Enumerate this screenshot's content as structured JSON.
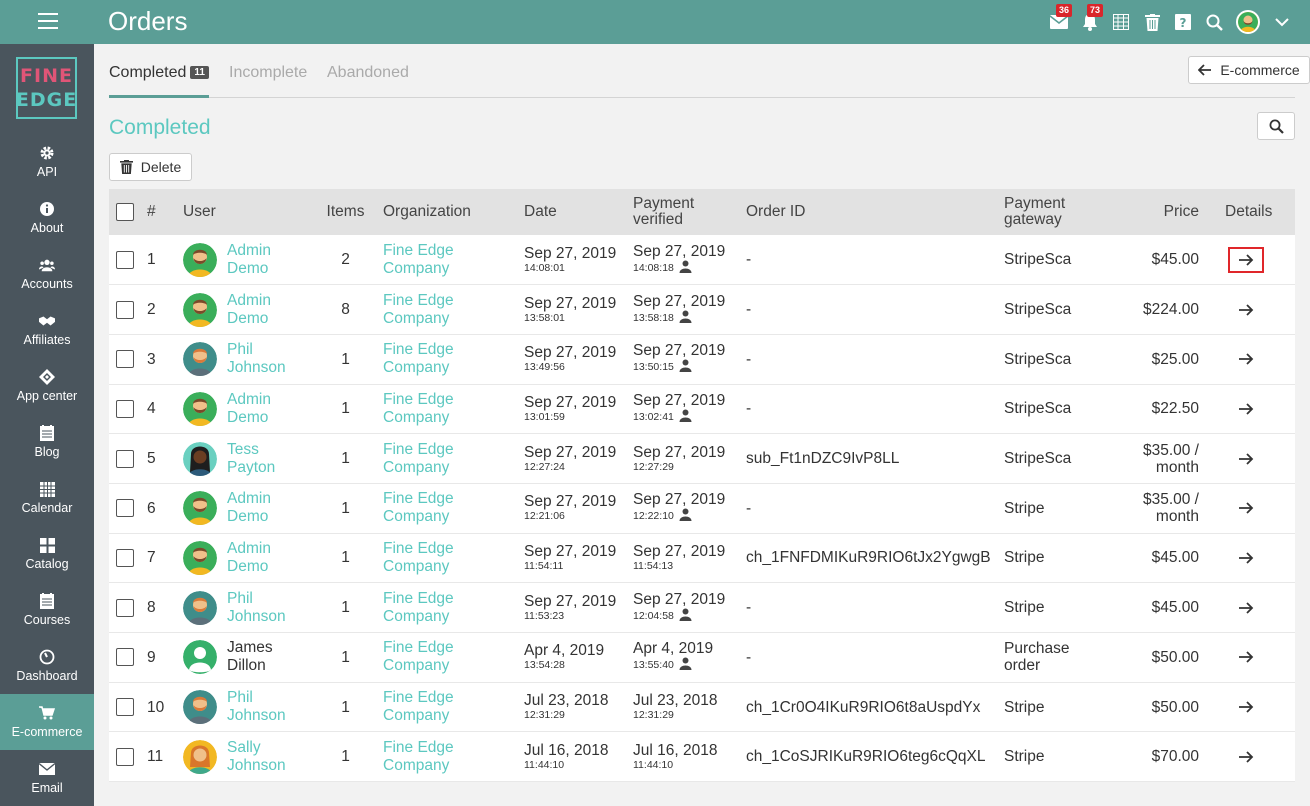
{
  "header": {
    "title": "Orders",
    "mail_badge": "36",
    "notifications_badge": "73"
  },
  "logo": {
    "line1": "FINE",
    "line2": "EDGE"
  },
  "sidebar": {
    "items": [
      {
        "label": "API",
        "icon": "gear-icon"
      },
      {
        "label": "About",
        "icon": "info-icon"
      },
      {
        "label": "Accounts",
        "icon": "users-icon"
      },
      {
        "label": "Affiliates",
        "icon": "handshake-icon"
      },
      {
        "label": "App center",
        "icon": "diamond-icon"
      },
      {
        "label": "Blog",
        "icon": "blog-icon"
      },
      {
        "label": "Calendar",
        "icon": "calendar-icon"
      },
      {
        "label": "Catalog",
        "icon": "grid-icon"
      },
      {
        "label": "Courses",
        "icon": "courses-icon"
      },
      {
        "label": "Dashboard",
        "icon": "dashboard-icon"
      },
      {
        "label": "E-commerce",
        "icon": "cart-icon"
      },
      {
        "label": "Email",
        "icon": "envelope-icon"
      }
    ],
    "active": "E-commerce"
  },
  "tabs": [
    {
      "label": "Completed",
      "count": "11"
    },
    {
      "label": "Incomplete"
    },
    {
      "label": "Abandoned"
    }
  ],
  "back_button": "E-commerce",
  "section_title": "Completed",
  "delete_button": "Delete",
  "table": {
    "headers": {
      "num": "#",
      "user": "User",
      "items": "Items",
      "organization": "Organization",
      "date": "Date",
      "payment_verified": "Payment verified",
      "order_id": "Order ID",
      "gateway": "Payment gateway",
      "price": "Price",
      "details": "Details"
    },
    "rows": [
      {
        "num": "1",
        "user": [
          "Admin",
          "Demo"
        ],
        "user_link": true,
        "avatar": "green",
        "items": "2",
        "org": [
          "Fine Edge",
          "Company"
        ],
        "date": "Sep 27, 2019",
        "time": "14:08:01",
        "pv_date": "Sep 27, 2019",
        "pv_time": "14:08:18",
        "pv_user": true,
        "order_id": "-",
        "gateway": "StripeSca",
        "price": "$45.00",
        "highlight": true
      },
      {
        "num": "2",
        "user": [
          "Admin",
          "Demo"
        ],
        "user_link": true,
        "avatar": "green",
        "items": "8",
        "org": [
          "Fine Edge",
          "Company"
        ],
        "date": "Sep 27, 2019",
        "time": "13:58:01",
        "pv_date": "Sep 27, 2019",
        "pv_time": "13:58:18",
        "pv_user": true,
        "order_id": "-",
        "gateway": "StripeSca",
        "price": "$224.00"
      },
      {
        "num": "3",
        "user": [
          "Phil",
          "Johnson"
        ],
        "user_link": true,
        "avatar": "teal",
        "items": "1",
        "org": [
          "Fine Edge",
          "Company"
        ],
        "date": "Sep 27, 2019",
        "time": "13:49:56",
        "pv_date": "Sep 27, 2019",
        "pv_time": "13:50:15",
        "pv_user": true,
        "order_id": "-",
        "gateway": "StripeSca",
        "price": "$25.00"
      },
      {
        "num": "4",
        "user": [
          "Admin",
          "Demo"
        ],
        "user_link": true,
        "avatar": "green",
        "items": "1",
        "org": [
          "Fine Edge",
          "Company"
        ],
        "date": "Sep 27, 2019",
        "time": "13:01:59",
        "pv_date": "Sep 27, 2019",
        "pv_time": "13:02:41",
        "pv_user": true,
        "order_id": "-",
        "gateway": "StripeSca",
        "price": "$22.50"
      },
      {
        "num": "5",
        "user": [
          "Tess",
          "Payton"
        ],
        "user_link": true,
        "avatar": "dark",
        "items": "1",
        "org": [
          "Fine Edge",
          "Company"
        ],
        "date": "Sep 27, 2019",
        "time": "12:27:24",
        "pv_date": "Sep 27, 2019",
        "pv_time": "12:27:29",
        "pv_user": false,
        "order_id": "sub_Ft1nDZC9IvP8LL",
        "gateway": "StripeSca",
        "price": [
          "$35.00 /",
          "month"
        ]
      },
      {
        "num": "6",
        "user": [
          "Admin",
          "Demo"
        ],
        "user_link": true,
        "avatar": "green",
        "items": "1",
        "org": [
          "Fine Edge",
          "Company"
        ],
        "date": "Sep 27, 2019",
        "time": "12:21:06",
        "pv_date": "Sep 27, 2019",
        "pv_time": "12:22:10",
        "pv_user": true,
        "order_id": "-",
        "gateway": "Stripe",
        "price": [
          "$35.00 /",
          "month"
        ]
      },
      {
        "num": "7",
        "user": [
          "Admin",
          "Demo"
        ],
        "user_link": true,
        "avatar": "green",
        "items": "1",
        "org": [
          "Fine Edge",
          "Company"
        ],
        "date": "Sep 27, 2019",
        "time": "11:54:11",
        "pv_date": "Sep 27, 2019",
        "pv_time": "11:54:13",
        "pv_user": false,
        "order_id": "ch_1FNFDMIKuR9RIO6tJx2YgwgB",
        "gateway": "Stripe",
        "price": "$45.00"
      },
      {
        "num": "8",
        "user": [
          "Phil",
          "Johnson"
        ],
        "user_link": true,
        "avatar": "teal",
        "items": "1",
        "org": [
          "Fine Edge",
          "Company"
        ],
        "date": "Sep 27, 2019",
        "time": "11:53:23",
        "pv_date": "Sep 27, 2019",
        "pv_time": "12:04:58",
        "pv_user": true,
        "order_id": "-",
        "gateway": "Stripe",
        "price": "$45.00"
      },
      {
        "num": "9",
        "user": [
          "James",
          "Dillon"
        ],
        "user_link": false,
        "avatar": "placeholder",
        "items": "1",
        "org": [
          "Fine Edge",
          "Company"
        ],
        "date": "Apr 4, 2019",
        "time": "13:54:28",
        "pv_date": "Apr 4, 2019",
        "pv_time": "13:55:40",
        "pv_user": true,
        "order_id": "-",
        "gateway": [
          "Purchase",
          "order"
        ],
        "price": "$50.00"
      },
      {
        "num": "10",
        "user": [
          "Phil",
          "Johnson"
        ],
        "user_link": true,
        "avatar": "teal",
        "items": "1",
        "org": [
          "Fine Edge",
          "Company"
        ],
        "date": "Jul 23, 2018",
        "time": "12:31:29",
        "pv_date": "Jul 23, 2018",
        "pv_time": "12:31:29",
        "pv_user": false,
        "order_id": "ch_1Cr0O4IKuR9RIO6t8aUspdYx",
        "gateway": "Stripe",
        "price": "$50.00"
      },
      {
        "num": "11",
        "user": [
          "Sally",
          "Johnson"
        ],
        "user_link": true,
        "avatar": "yellow",
        "items": "1",
        "org": [
          "Fine Edge",
          "Company"
        ],
        "date": "Jul 16, 2018",
        "time": "11:44:10",
        "pv_date": "Jul 16, 2018",
        "pv_time": "11:44:10",
        "pv_user": false,
        "order_id": "ch_1CoSJRIKuR9RIO6teg6cQqXL",
        "gateway": "Stripe",
        "price": "$70.00"
      }
    ]
  },
  "colors": {
    "topbar": "#5b9e96",
    "sidebar": "#4a555d",
    "accent": "#5cc8c0",
    "highlight_border": "#e0262a"
  }
}
